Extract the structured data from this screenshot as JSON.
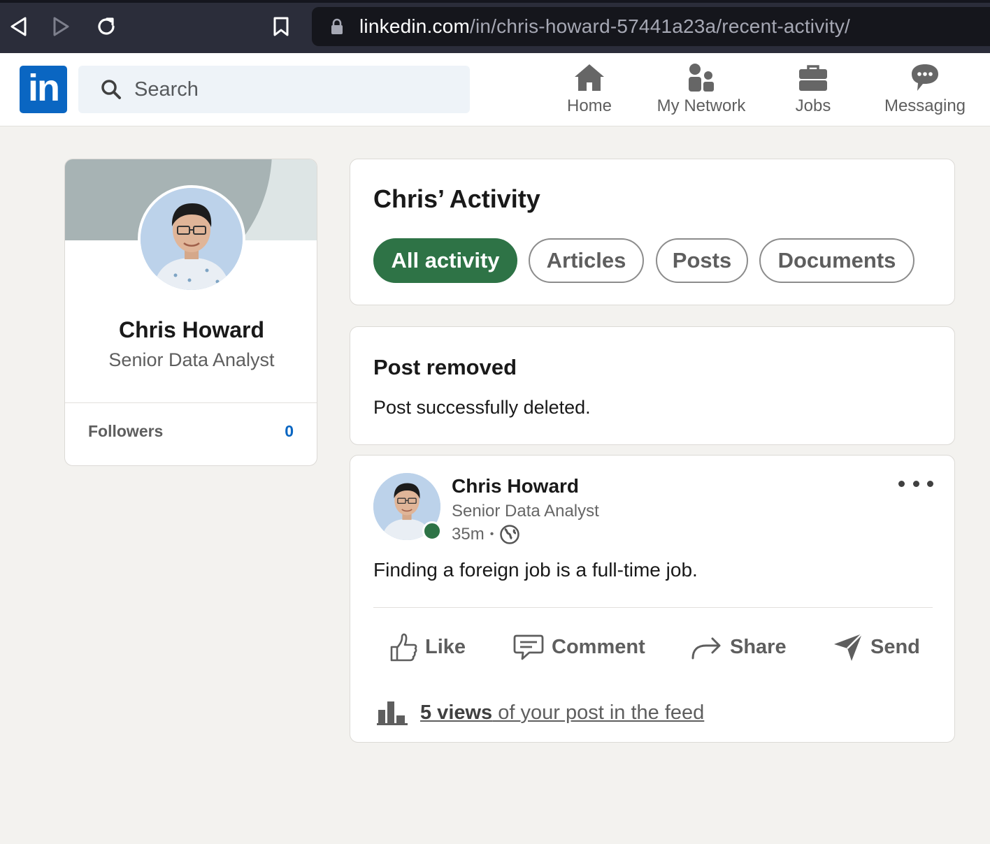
{
  "browser": {
    "url_domain": "linkedin.com",
    "url_path": "/in/chris-howard-57441a23a/recent-activity/"
  },
  "header": {
    "logo": "in",
    "search_placeholder": "Search",
    "nav": [
      {
        "label": "Home",
        "icon": "home-icon"
      },
      {
        "label": "My Network",
        "icon": "network-icon"
      },
      {
        "label": "Jobs",
        "icon": "briefcase-icon"
      },
      {
        "label": "Messaging",
        "icon": "messaging-icon"
      }
    ]
  },
  "profile": {
    "name": "Chris Howard",
    "headline": "Senior Data Analyst",
    "followers_label": "Followers",
    "followers_count": "0"
  },
  "activity": {
    "title": "Chris’ Activity",
    "filters": [
      {
        "label": "All activity",
        "active": true
      },
      {
        "label": "Articles",
        "active": false
      },
      {
        "label": "Posts",
        "active": false
      },
      {
        "label": "Documents",
        "active": false
      }
    ]
  },
  "notice": {
    "title": "Post removed",
    "message": "Post successfully deleted."
  },
  "post": {
    "author": "Chris Howard",
    "headline": "Senior Data Analyst",
    "time": "35m",
    "separator": "•",
    "text": "Finding a foreign job is a full-time job.",
    "actions": {
      "like": "Like",
      "comment": "Comment",
      "share": "Share",
      "send": "Send"
    },
    "views_count_text": "5 views",
    "views_suffix": " of your post in the feed"
  },
  "colors": {
    "brand_blue": "#0a66c2",
    "active_green": "#2e7346",
    "page_bg": "#f3f2ef"
  }
}
